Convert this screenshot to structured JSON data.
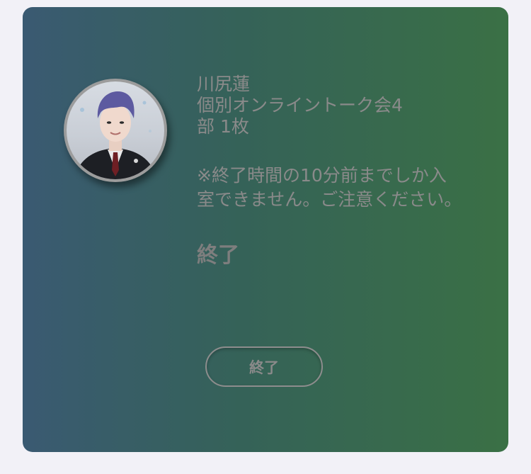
{
  "card": {
    "name_line": "川尻蓮",
    "event_line_1": "個別オンライントーク会4",
    "event_line_2": "部 1枚",
    "note": "※終了時間の10分前までしか入室できません。ご注意ください。",
    "status": "終了",
    "button_label": "終了"
  },
  "colors": {
    "page_background": "#f2f1f7",
    "gradient_start": "#3a5a72",
    "gradient_end": "#3a7045",
    "text": "#8a8a8a"
  }
}
